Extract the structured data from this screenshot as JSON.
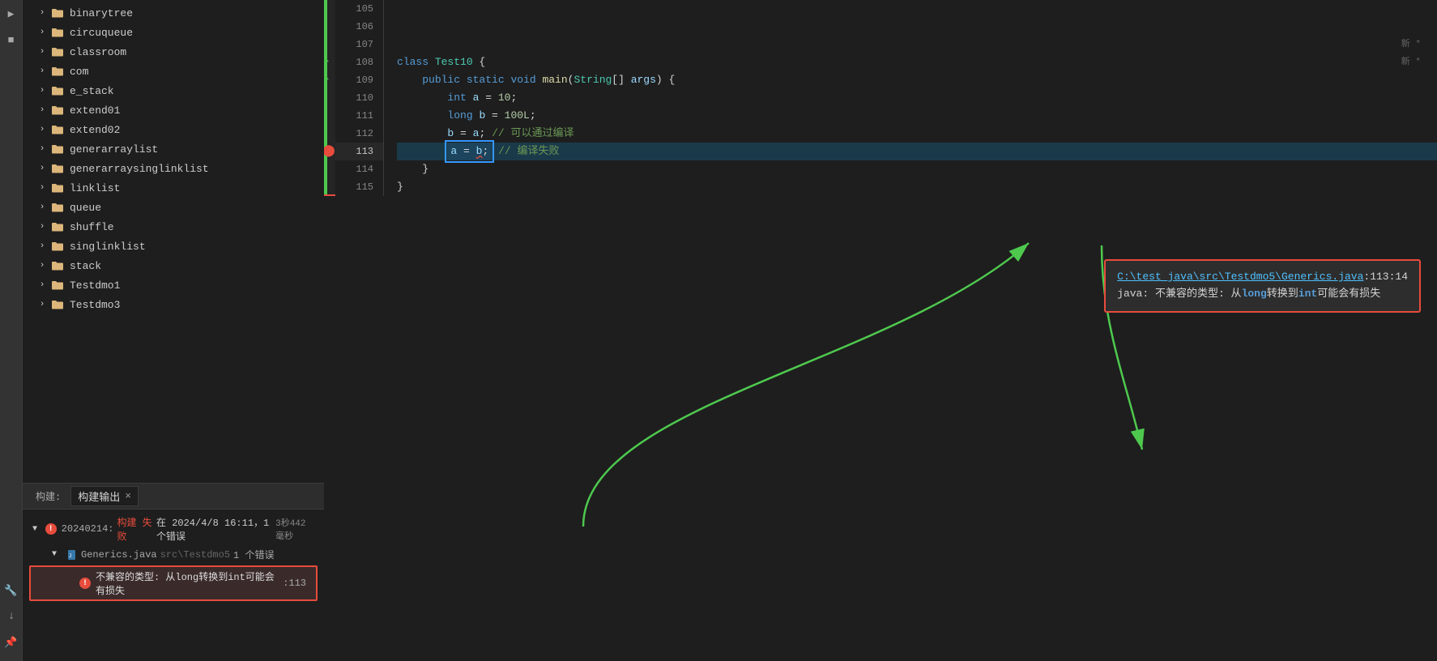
{
  "sidebar": {
    "tree_items": [
      {
        "label": "binarytree",
        "indent": 0
      },
      {
        "label": "circuqueue",
        "indent": 0
      },
      {
        "label": "classroom",
        "indent": 0
      },
      {
        "label": "com",
        "indent": 0
      },
      {
        "label": "e_stack",
        "indent": 0
      },
      {
        "label": "extend01",
        "indent": 0
      },
      {
        "label": "extend02",
        "indent": 0
      },
      {
        "label": "generarraylist",
        "indent": 0
      },
      {
        "label": "generarraysinglinklist",
        "indent": 0
      },
      {
        "label": "linklist",
        "indent": 0
      },
      {
        "label": "queue",
        "indent": 0
      },
      {
        "label": "shuffle",
        "indent": 0
      },
      {
        "label": "singlinklist",
        "indent": 0
      },
      {
        "label": "stack",
        "indent": 0
      },
      {
        "label": "Testdmo1",
        "indent": 0
      },
      {
        "label": "Testdmo3",
        "indent": 0
      }
    ]
  },
  "bottom_panel": {
    "tab_label": "构建输出",
    "tab_close": "×",
    "prefix_label": "构建:",
    "build_entry": {
      "id": "20240214",
      "status_text": "构建 失败",
      "date_text": "在 2024/4/8 16:11，1 个错误",
      "time_text": "3秒442毫秒",
      "sub_file": "Generics.java",
      "sub_path": "src\\Testdmo5",
      "sub_errors": "1 个错误",
      "error_msg": "不兼容的类型: 从long转换到int可能会有损失",
      "error_line": ":113"
    }
  },
  "editor": {
    "lines": [
      {
        "num": 105,
        "content": ""
      },
      {
        "num": 106,
        "content": ""
      },
      {
        "num": 107,
        "content": ""
      },
      {
        "num": 108,
        "content": "class Test10 {",
        "has_run_arrow": true,
        "has_new_label": true
      },
      {
        "num": 109,
        "content": "    public static void main(String[] args) {",
        "has_run_arrow": true,
        "has_new_label": true
      },
      {
        "num": 110,
        "content": "        int a = 10;"
      },
      {
        "num": 111,
        "content": "        long b = 100L;"
      },
      {
        "num": 112,
        "content": "        b = a; // 可以通过编译",
        "has_red_indicator": true
      },
      {
        "num": 113,
        "content": "        a = b; // 编译失败",
        "is_error": true,
        "has_breakpoint": true,
        "is_active": true
      },
      {
        "num": 114,
        "content": "    }",
        "has_save_icon": true
      },
      {
        "num": 115,
        "content": "}",
        "has_save_icon": true
      }
    ]
  },
  "error_tooltip": {
    "file_path": "C:\\test_java\\src\\Testdmo5\\Generics.java",
    "line_col": ":113:14",
    "error_line1": "java: 不兼容的类型: 从",
    "keyword_long": "long",
    "error_line1b": "转换到",
    "keyword_int": "int",
    "error_line1c": "可能会有损失"
  },
  "action_icons": {
    "run": "▶",
    "stop": "■",
    "wrench": "🔧",
    "up_arrow": "↑",
    "pin": "📌"
  }
}
